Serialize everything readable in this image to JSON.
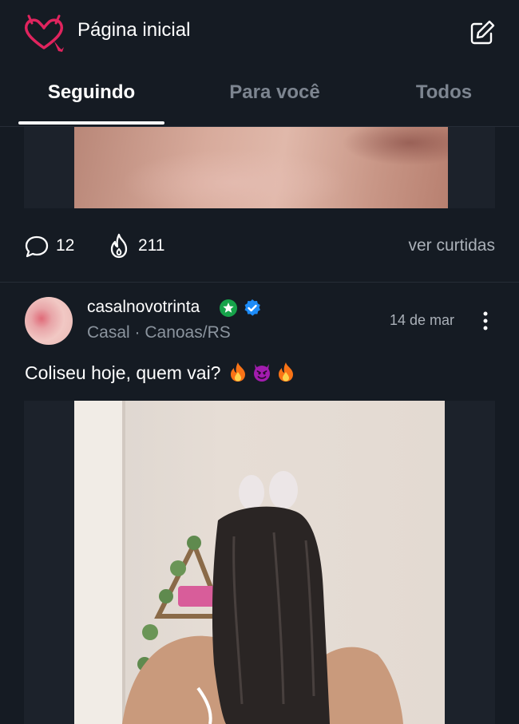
{
  "header": {
    "title": "Página inicial",
    "logo_icon": "heart-devil-icon",
    "compose_icon": "edit-icon",
    "brand_color": "#e0245e"
  },
  "tabs": [
    {
      "label": "Seguindo",
      "active": true
    },
    {
      "label": "Para você",
      "active": false
    },
    {
      "label": "Todos",
      "active": false
    }
  ],
  "previous_post": {
    "comments": "12",
    "likes": "211",
    "view_likes_label": "ver curtidas",
    "comment_icon": "comment-icon",
    "like_icon": "flame-icon"
  },
  "post": {
    "username": "casalnovotrinta",
    "badges": [
      "star-badge-icon",
      "verified-badge-icon"
    ],
    "subtitle": "Casal · Canoas/RS",
    "date": "14 de mar",
    "caption": "Coliseu hoje, quem vai?",
    "caption_emojis": [
      "fire-icon",
      "devil-icon",
      "fire-icon"
    ],
    "more_icon": "more-vertical-icon"
  },
  "colors": {
    "background": "#151b23",
    "verified": "#1d8cf8",
    "star_badge": "#16a34a",
    "muted_text": "#8b949e"
  }
}
